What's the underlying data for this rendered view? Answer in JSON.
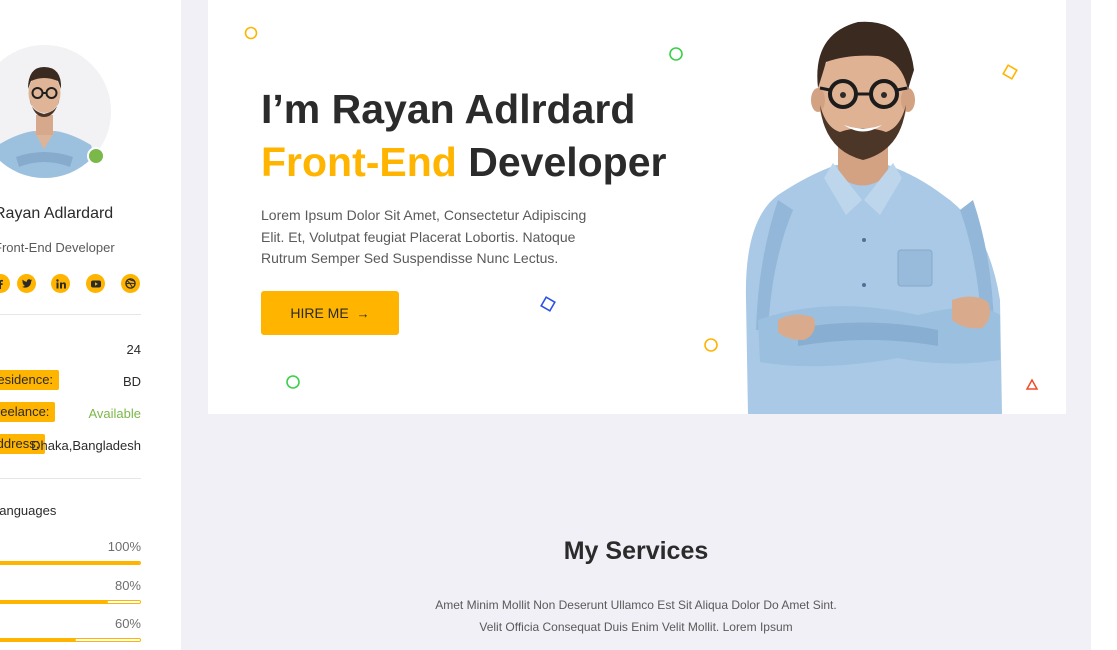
{
  "sidebar": {
    "name": "Rayan Adlardard",
    "role": "Front-End Developer",
    "social": [
      {
        "icon": "facebook-icon"
      },
      {
        "icon": "twitter-icon"
      },
      {
        "icon": "linkedin-icon"
      },
      {
        "icon": "youtube-icon"
      },
      {
        "icon": "dribbble-icon"
      }
    ],
    "info": [
      {
        "label": "",
        "value": "24"
      },
      {
        "label": "Residence:",
        "value": "BD"
      },
      {
        "label": "Freelance:",
        "value": "Available"
      },
      {
        "label": "Address:",
        "value": "Dhaka,Bangladesh"
      }
    ],
    "languages_title": "Languages",
    "skills": [
      {
        "percent_label": "100%",
        "level": 1.0
      },
      {
        "percent_label": "80%",
        "level": 0.8
      },
      {
        "percent_label": "60%",
        "level": 0.6
      }
    ]
  },
  "hero": {
    "line1": "I’m Rayan Adlrdard",
    "line2_accent": "Front-End",
    "line2_rest": " Developer",
    "description": "Lorem Ipsum Dolor Sit Amet, Consectetur Adipiscing Elit. Et, Volutpat feugiat Placerat Lobortis. Natoque Rutrum Semper Sed Suspendisse Nunc Lectus.",
    "cta_label": "HIRE ME",
    "cta_arrow": "→"
  },
  "services": {
    "title": "My Services",
    "description": "Amet Minim Mollit Non Deserunt Ullamco Est Sit Aliqua Dolor Do Amet Sint. Velit Officia Consequat Duis Enim Velit Mollit. Lorem Ipsum"
  },
  "colors": {
    "accent": "#ffb400",
    "available": "#7bb84a",
    "online": "#7bb84a",
    "background": "#f0f0f6"
  }
}
